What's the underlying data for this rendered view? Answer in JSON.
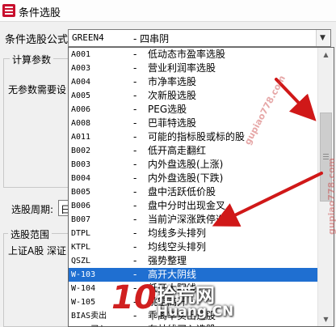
{
  "window": {
    "title": "条件选股"
  },
  "form": {
    "formula_label": "条件选股公式",
    "selected_code": "GREEN4",
    "selected_desc": "- 四串阴",
    "params_group_title": "计算参数",
    "no_params_text": "无参数需要设",
    "period_label": "选股周期:",
    "period_value": "日",
    "scope_group_title": "选股范围",
    "scope_text": "上证A股 深证"
  },
  "dropdown": {
    "selected_index": 16,
    "items": [
      {
        "code": "A001",
        "desc": "低动态市盈率选股"
      },
      {
        "code": "A003",
        "desc": "营业利润率选股"
      },
      {
        "code": "A004",
        "desc": "市净率选股"
      },
      {
        "code": "A005",
        "desc": "次新股选股"
      },
      {
        "code": "A006",
        "desc": "PEG选股"
      },
      {
        "code": "A008",
        "desc": "巴菲特选股"
      },
      {
        "code": "A011",
        "desc": "可能的指标股或标的股"
      },
      {
        "code": "B002",
        "desc": "低开高走翻红"
      },
      {
        "code": "B003",
        "desc": "内外盘选股(上涨)"
      },
      {
        "code": "B004",
        "desc": "内外盘选股(下跌)"
      },
      {
        "code": "B005",
        "desc": "盘中活跃低价股"
      },
      {
        "code": "B006",
        "desc": "盘中分时出现金叉"
      },
      {
        "code": "B007",
        "desc": "当前沪深涨跌停选股"
      },
      {
        "code": "DTPL",
        "desc": "均线多头排列"
      },
      {
        "code": "KTPL",
        "desc": "均线空头排列"
      },
      {
        "code": "QSZL",
        "desc": "强势整理"
      },
      {
        "code": "W-103",
        "desc": "高开大阴线"
      },
      {
        "code": "W-104",
        "desc": "低开大阳线"
      },
      {
        "code": "W-105",
        "desc": "跳空高开"
      },
      {
        "code": "BIAS卖出",
        "desc": "乖离率卖出选股"
      },
      {
        "code": "BOLL买入",
        "desc": "布林线买入选股"
      }
    ]
  },
  "watermarks": {
    "site": "gupiao778.com"
  },
  "logo": {
    "ten": "10",
    "cn": "拾荒网",
    "site": "Huang.CN"
  },
  "icons": {
    "scroll_up": "scroll-up-arrow-icon",
    "scroll_down": "scroll-down-arrow-icon",
    "combo": "chevron-down-icon"
  }
}
